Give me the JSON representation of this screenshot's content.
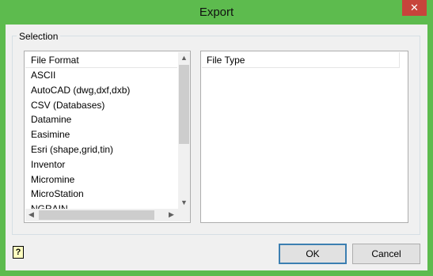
{
  "window": {
    "title": "Export",
    "close_glyph": "✕"
  },
  "selection": {
    "group_label": "Selection",
    "file_format": {
      "header": "File Format",
      "items": [
        "ASCII",
        "AutoCAD (dwg,dxf,dxb)",
        "CSV (Databases)",
        "Datamine",
        "Easimine",
        "Esri (shape,grid,tin)",
        "Inventor",
        "Micromine",
        "MicroStation",
        "NGRAIN"
      ]
    },
    "file_type": {
      "header": "File Type"
    }
  },
  "scrollbar_glyphs": {
    "up": "▲",
    "down": "▼",
    "left": "◀",
    "right": "▶"
  },
  "help": {
    "glyph": "?"
  },
  "buttons": {
    "ok": "OK",
    "cancel": "Cancel"
  }
}
